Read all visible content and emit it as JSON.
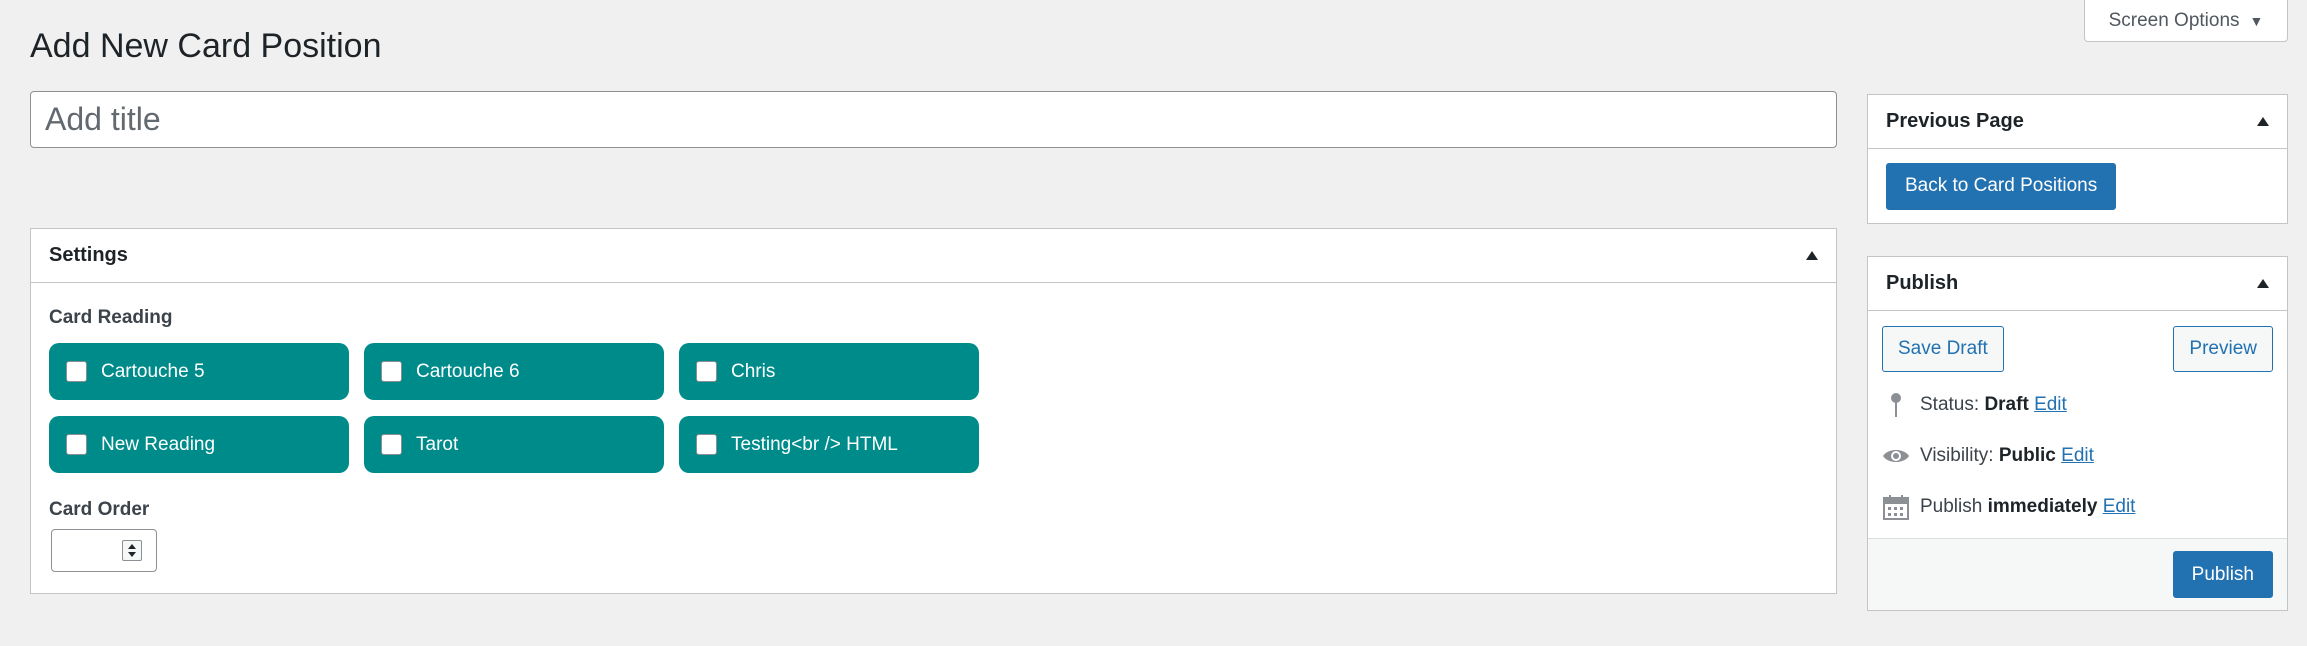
{
  "screen_options": {
    "label": "Screen Options",
    "caret": "▼"
  },
  "page_title": "Add New Card Position",
  "title_field": {
    "placeholder": "Add title",
    "value": ""
  },
  "settings": {
    "heading": "Settings",
    "card_reading_label": "Card Reading",
    "readings": [
      {
        "label": "Cartouche 5",
        "checked": false
      },
      {
        "label": "Cartouche 6",
        "checked": false
      },
      {
        "label": "Chris",
        "checked": false
      },
      {
        "label": "New Reading",
        "checked": false
      },
      {
        "label": "Tarot",
        "checked": false
      },
      {
        "label": "Testing<br /> HTML",
        "checked": false
      }
    ],
    "card_order_label": "Card Order",
    "card_order_value": ""
  },
  "previous_page": {
    "heading": "Previous Page",
    "button_label": "Back to Card Positions"
  },
  "publish": {
    "heading": "Publish",
    "save_draft_label": "Save Draft",
    "preview_label": "Preview",
    "status": {
      "label": "Status:",
      "value": "Draft",
      "edit": "Edit"
    },
    "visibility": {
      "label": "Visibility:",
      "value": "Public",
      "edit": "Edit"
    },
    "schedule": {
      "label": "Publish",
      "value": "immediately",
      "edit": "Edit"
    },
    "publish_label": "Publish"
  },
  "colors": {
    "background": "#f0f0f1",
    "reading_option": "#008b8b",
    "primary_button": "#2271b1"
  }
}
